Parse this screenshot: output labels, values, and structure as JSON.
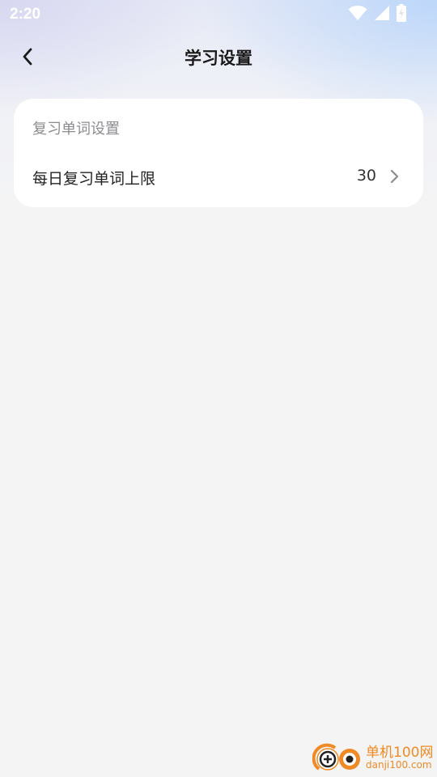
{
  "status_bar": {
    "time": "2:20",
    "icons": [
      "wifi-icon",
      "signal-icon",
      "battery-charging-icon"
    ]
  },
  "header": {
    "title": "学习设置",
    "back_icon": "chevron-left-icon"
  },
  "review_section": {
    "title": "复习单词设置",
    "items": [
      {
        "label": "每日复习单词上限",
        "value": "30",
        "icon": "chevron-right-icon"
      }
    ]
  },
  "watermark": {
    "brand": "单机100网",
    "domain": "danji100.com"
  },
  "colors": {
    "background": "#f4f4f5",
    "card": "#ffffff",
    "title_text": "#1a1a1a",
    "section_text": "#8c8c90",
    "watermark": "#f08a24"
  }
}
